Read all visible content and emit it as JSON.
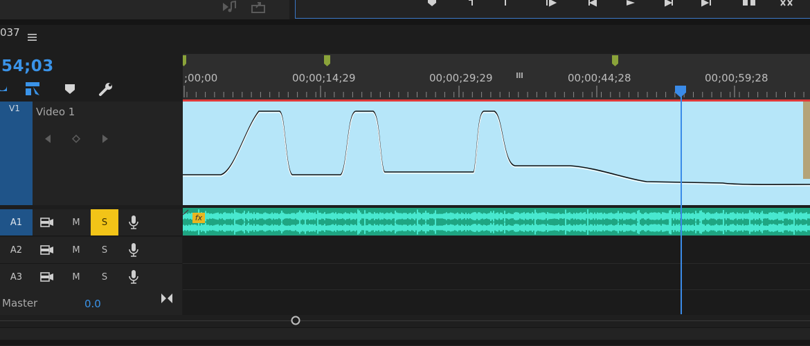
{
  "sequence": {
    "tab_name": "037"
  },
  "header": {
    "timecode": "54;03"
  },
  "ruler": {
    "timecodes": [
      ";00;00",
      "00;00;14;29",
      "00;00;29;29",
      "00;00;44;28",
      "00;00;59;28"
    ]
  },
  "tracks": {
    "video": [
      {
        "id": "V1",
        "name": "Video 1"
      }
    ],
    "audio": [
      {
        "id": "A1",
        "selected": true,
        "mute": "M",
        "solo": "S",
        "solo_active": true
      },
      {
        "id": "A2",
        "selected": false,
        "mute": "M",
        "solo": "S",
        "solo_active": false
      },
      {
        "id": "A3",
        "selected": false,
        "mute": "M",
        "solo": "S",
        "solo_active": false
      }
    ],
    "master": {
      "label": "Master",
      "value": "0.0"
    }
  },
  "clip": {
    "effect_badge": "fx"
  },
  "colors": {
    "timecode": "#3a93e8",
    "video_clip": "#b6e6f9",
    "audio_clip": "#1fa582",
    "audio_wave": "#48e8cf",
    "playhead": "#3a8be8",
    "solo_active": "#f2c418",
    "selected_track": "#1f5489",
    "work_area_line": "#e03a3a"
  }
}
